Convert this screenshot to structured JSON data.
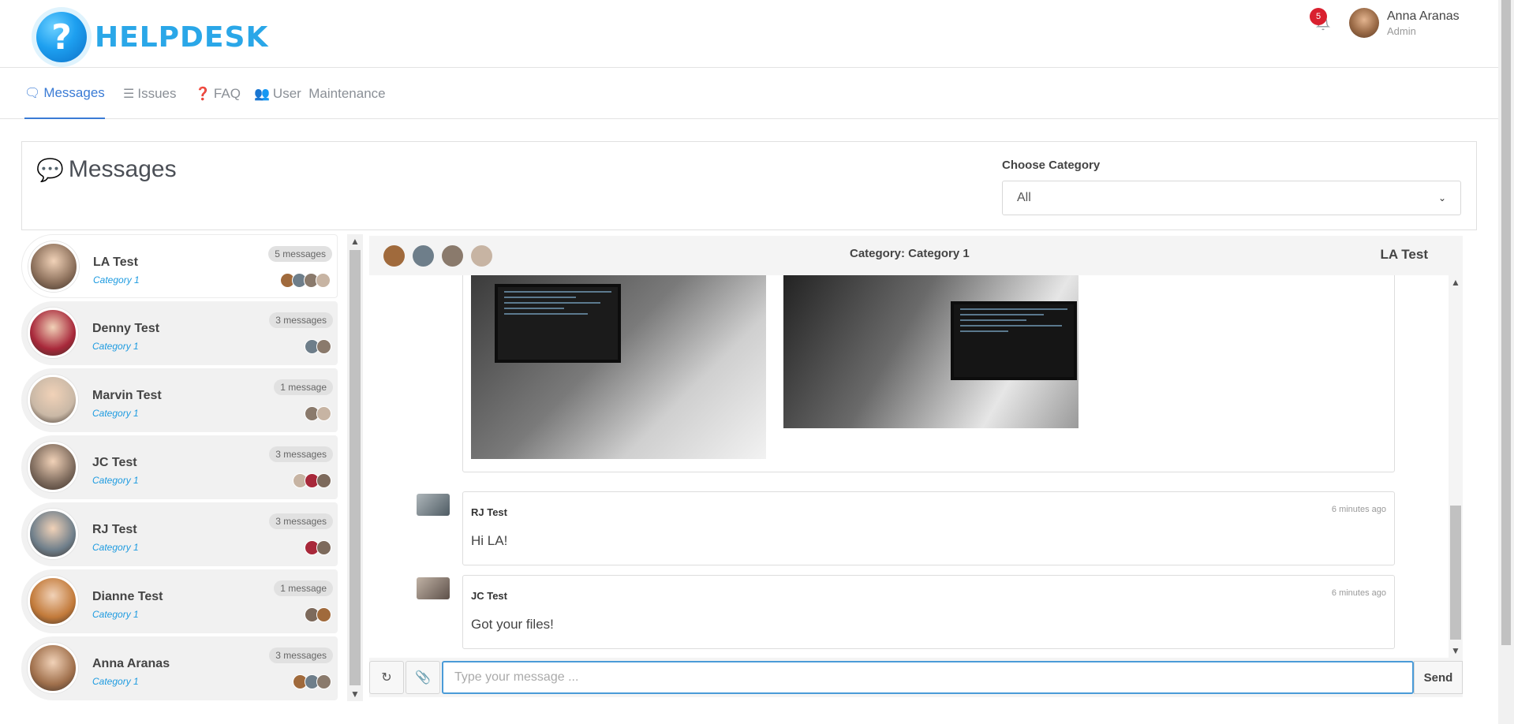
{
  "app": {
    "logo_text": "HELPDESK",
    "logo_glyph": "?"
  },
  "header": {
    "notification_count": "5",
    "user": {
      "name": "Anna Aranas",
      "role": "Admin"
    }
  },
  "nav": {
    "items": [
      {
        "label": "Messages",
        "icon": "comments-icon",
        "active": true
      },
      {
        "label": "Issues",
        "icon": "tasks-icon",
        "active": false
      },
      {
        "label": "FAQ",
        "icon": "question-circle-icon",
        "active": false
      },
      {
        "label": "User  Maintenance",
        "icon": "users-icon",
        "active": false
      }
    ]
  },
  "page": {
    "title": "Messages",
    "category_label": "Choose Category",
    "category_selected": "All"
  },
  "conversations": [
    {
      "name": "LA Test",
      "category": "Category 1",
      "count": "5 messages",
      "participants": 4,
      "avatar_color": "#8b6f5a",
      "active": true
    },
    {
      "name": "Denny Test",
      "category": "Category 1",
      "count": "3 messages",
      "participants": 2,
      "avatar_color": "#a8283a",
      "active": false
    },
    {
      "name": "Marvin Test",
      "category": "Category 1",
      "count": "1 message",
      "participants": 2,
      "avatar_color": "#c9b8a6",
      "active": false
    },
    {
      "name": "JC Test",
      "category": "Category 1",
      "count": "3 messages",
      "participants": 3,
      "avatar_color": "#7d6a5c",
      "active": false
    },
    {
      "name": "RJ Test",
      "category": "Category 1",
      "count": "3 messages",
      "participants": 2,
      "avatar_color": "#6e7e8a",
      "active": false
    },
    {
      "name": "Dianne Test",
      "category": "Category 1",
      "count": "1 message",
      "participants": 2,
      "avatar_color": "#c27a3a",
      "active": false
    },
    {
      "name": "Anna Aranas",
      "category": "Category 1",
      "count": "3 messages",
      "participants": 3,
      "avatar_color": "#a0704c",
      "active": false
    }
  ],
  "chat": {
    "category": "Category: Category 1",
    "title": "LA Test",
    "messages": [
      {
        "author": "RJ Test",
        "time": "6 minutes ago",
        "text": "Hi LA!"
      },
      {
        "author": "JC Test",
        "time": "6 minutes ago",
        "text": "Got your files!"
      }
    ],
    "composer": {
      "placeholder": "Type your message ...",
      "send_label": "Send"
    }
  },
  "colors": {
    "brand": "#2aa7e8",
    "accent": "#3a7bd5",
    "badge": "#d9202f",
    "category_link": "#1e9be0"
  }
}
